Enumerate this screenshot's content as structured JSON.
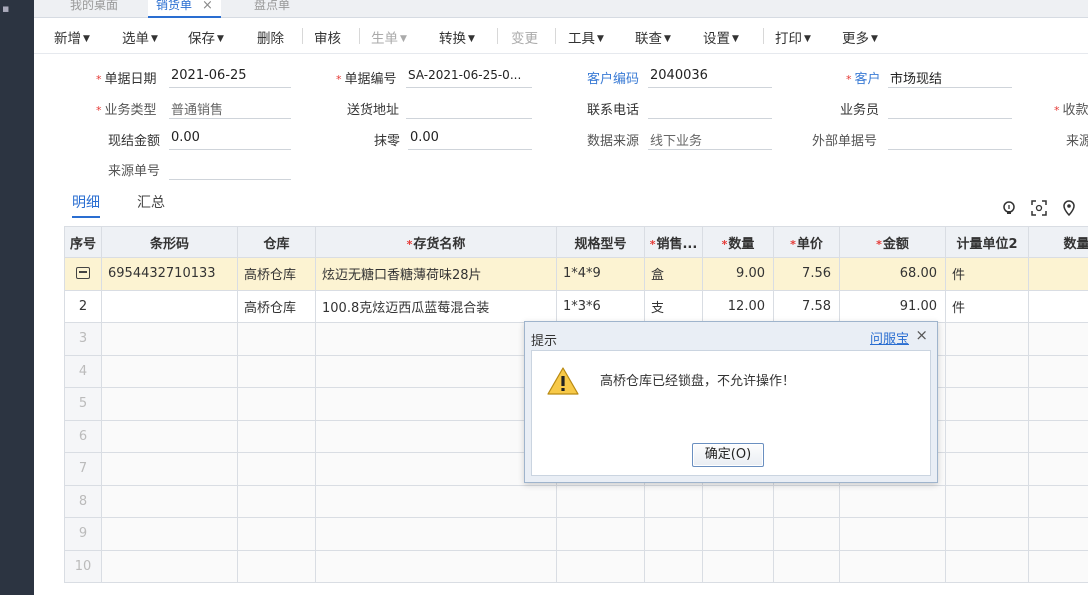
{
  "tabs": [
    {
      "label": "我的桌面",
      "active": false
    },
    {
      "label": "销货单",
      "active": true,
      "close": "×"
    },
    {
      "label": "盘点单",
      "active": false
    }
  ],
  "toolbar": [
    {
      "label": "新增",
      "caret": true,
      "disabled": false
    },
    {
      "label": "选单",
      "caret": true,
      "disabled": false
    },
    {
      "label": "保存",
      "caret": true,
      "disabled": false
    },
    {
      "label": "删除",
      "caret": false,
      "disabled": false
    },
    {
      "label": "审核",
      "caret": false,
      "disabled": false
    },
    {
      "label": "生单",
      "caret": true,
      "disabled": true
    },
    {
      "label": "转换",
      "caret": true,
      "disabled": false
    },
    {
      "label": "变更",
      "caret": false,
      "disabled": true
    },
    {
      "label": "工具",
      "caret": true,
      "disabled": false
    },
    {
      "label": "联查",
      "caret": true,
      "disabled": false
    },
    {
      "label": "设置",
      "caret": true,
      "disabled": false
    },
    {
      "label": "打印",
      "caret": true,
      "disabled": false
    },
    {
      "label": "更多",
      "caret": true,
      "disabled": false
    }
  ],
  "form": {
    "bill_date": {
      "label": "单据日期",
      "value": "2021-06-25",
      "required": true
    },
    "bill_no": {
      "label": "单据编号",
      "value": "SA-2021-06-25-0...",
      "required": true
    },
    "customer_code": {
      "label": "客户编码",
      "value": "2040036"
    },
    "customer": {
      "label": "客户",
      "value": "市场现结",
      "required": true
    },
    "biz_type": {
      "label": "业务类型",
      "value": "普通销售",
      "required": true
    },
    "delivery_address": {
      "label": "送货地址",
      "value": ""
    },
    "phone": {
      "label": "联系电话",
      "value": ""
    },
    "salesperson": {
      "label": "业务员",
      "value": ""
    },
    "receive_partial": {
      "label": "收款",
      "required": true
    },
    "cash_amount": {
      "label": "现结金额",
      "value": "0.00"
    },
    "round_off": {
      "label": "抹零",
      "value": "0.00"
    },
    "data_source": {
      "label": "数据来源",
      "value": "线下业务"
    },
    "external_no": {
      "label": "外部单据号",
      "value": ""
    },
    "source_partial": {
      "label": "来源"
    },
    "source_no": {
      "label": "来源单号",
      "value": ""
    }
  },
  "subtabs": {
    "detail": "明细",
    "summary": "汇总"
  },
  "grid": {
    "headers": [
      {
        "label": "序号",
        "required": false
      },
      {
        "label": "条形码",
        "required": false
      },
      {
        "label": "仓库",
        "required": false
      },
      {
        "label": "存货名称",
        "required": true
      },
      {
        "label": "规格型号",
        "required": false
      },
      {
        "label": "销售...",
        "required": true
      },
      {
        "label": "数量",
        "required": true
      },
      {
        "label": "单价",
        "required": true
      },
      {
        "label": "金额",
        "required": true
      },
      {
        "label": "计量单位2",
        "required": false
      },
      {
        "label": "数量",
        "required": false
      }
    ],
    "rows": [
      {
        "seq": "",
        "barcode": "6954432710133",
        "warehouse": "高桥仓库",
        "name": "炫迈无糖口香糖薄荷味28片",
        "spec": "1*4*9",
        "unit": "盒",
        "qty": "9.00",
        "price": "7.56",
        "amount": "68.00",
        "unit2": "件"
      },
      {
        "seq": "2",
        "barcode": "",
        "warehouse": "高桥仓库",
        "name": "100.8克炫迈西瓜蓝莓混合装",
        "spec": "1*3*6",
        "unit": "支",
        "qty": "12.00",
        "price": "7.58",
        "amount": "91.00",
        "unit2": "件"
      }
    ],
    "empty_rows": [
      "3",
      "4",
      "5",
      "6",
      "7",
      "8",
      "9",
      "10"
    ]
  },
  "dialog": {
    "title": "提示",
    "help_link": "问服宝",
    "close": "×",
    "message": "高桥仓库已经锁盘，不允许操作！",
    "ok_label": "确定(O)"
  },
  "colors": {
    "accent": "#2a6ed1",
    "required": "#e53935",
    "highlight_row": "#fcf3d2"
  }
}
